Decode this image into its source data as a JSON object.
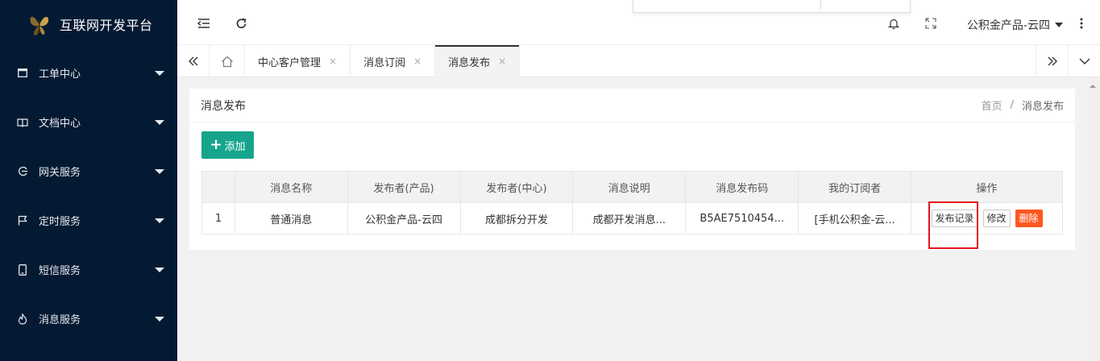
{
  "app": {
    "title": "互联网开发平台"
  },
  "sidebar": {
    "items": [
      {
        "label": "工单中心",
        "icon": "window-icon"
      },
      {
        "label": "文档中心",
        "icon": "book-icon"
      },
      {
        "label": "网关服务",
        "icon": "gateway-icon"
      },
      {
        "label": "定时服务",
        "icon": "flag-icon"
      },
      {
        "label": "短信服务",
        "icon": "phone-icon"
      },
      {
        "label": "消息服务",
        "icon": "flame-icon"
      }
    ]
  },
  "header": {
    "user_label": "公积金产品-云四"
  },
  "tabs": {
    "items": [
      {
        "label": "中心客户管理",
        "close": "×"
      },
      {
        "label": "消息订阅",
        "close": "×"
      },
      {
        "label": "消息发布",
        "close": "×",
        "active": true
      }
    ]
  },
  "page": {
    "title": "消息发布",
    "breadcrumb": {
      "home": "首页",
      "sep": "/",
      "current": "消息发布"
    },
    "add_plus": "+",
    "add_label": "添加"
  },
  "table": {
    "headers": [
      "",
      "消息名称",
      "发布者(产品)",
      "发布者(中心)",
      "消息说明",
      "消息发布码",
      "我的订阅者",
      "操作"
    ],
    "rows": [
      {
        "index": "1",
        "name": "普通消息",
        "publisher_product": "公积金产品-云四",
        "publisher_center": "成都拆分开发",
        "description": "成都开发消息...",
        "code": "B5AE7510454...",
        "subscribers": "[手机公积金-云...",
        "actions": {
          "records": "发布记录",
          "edit": "修改",
          "delete": "删除"
        }
      }
    ]
  },
  "colors": {
    "sidebar_bg": "#041a33",
    "primary": "#16a58c",
    "danger": "#ff5722",
    "highlight": "#e0141e"
  }
}
